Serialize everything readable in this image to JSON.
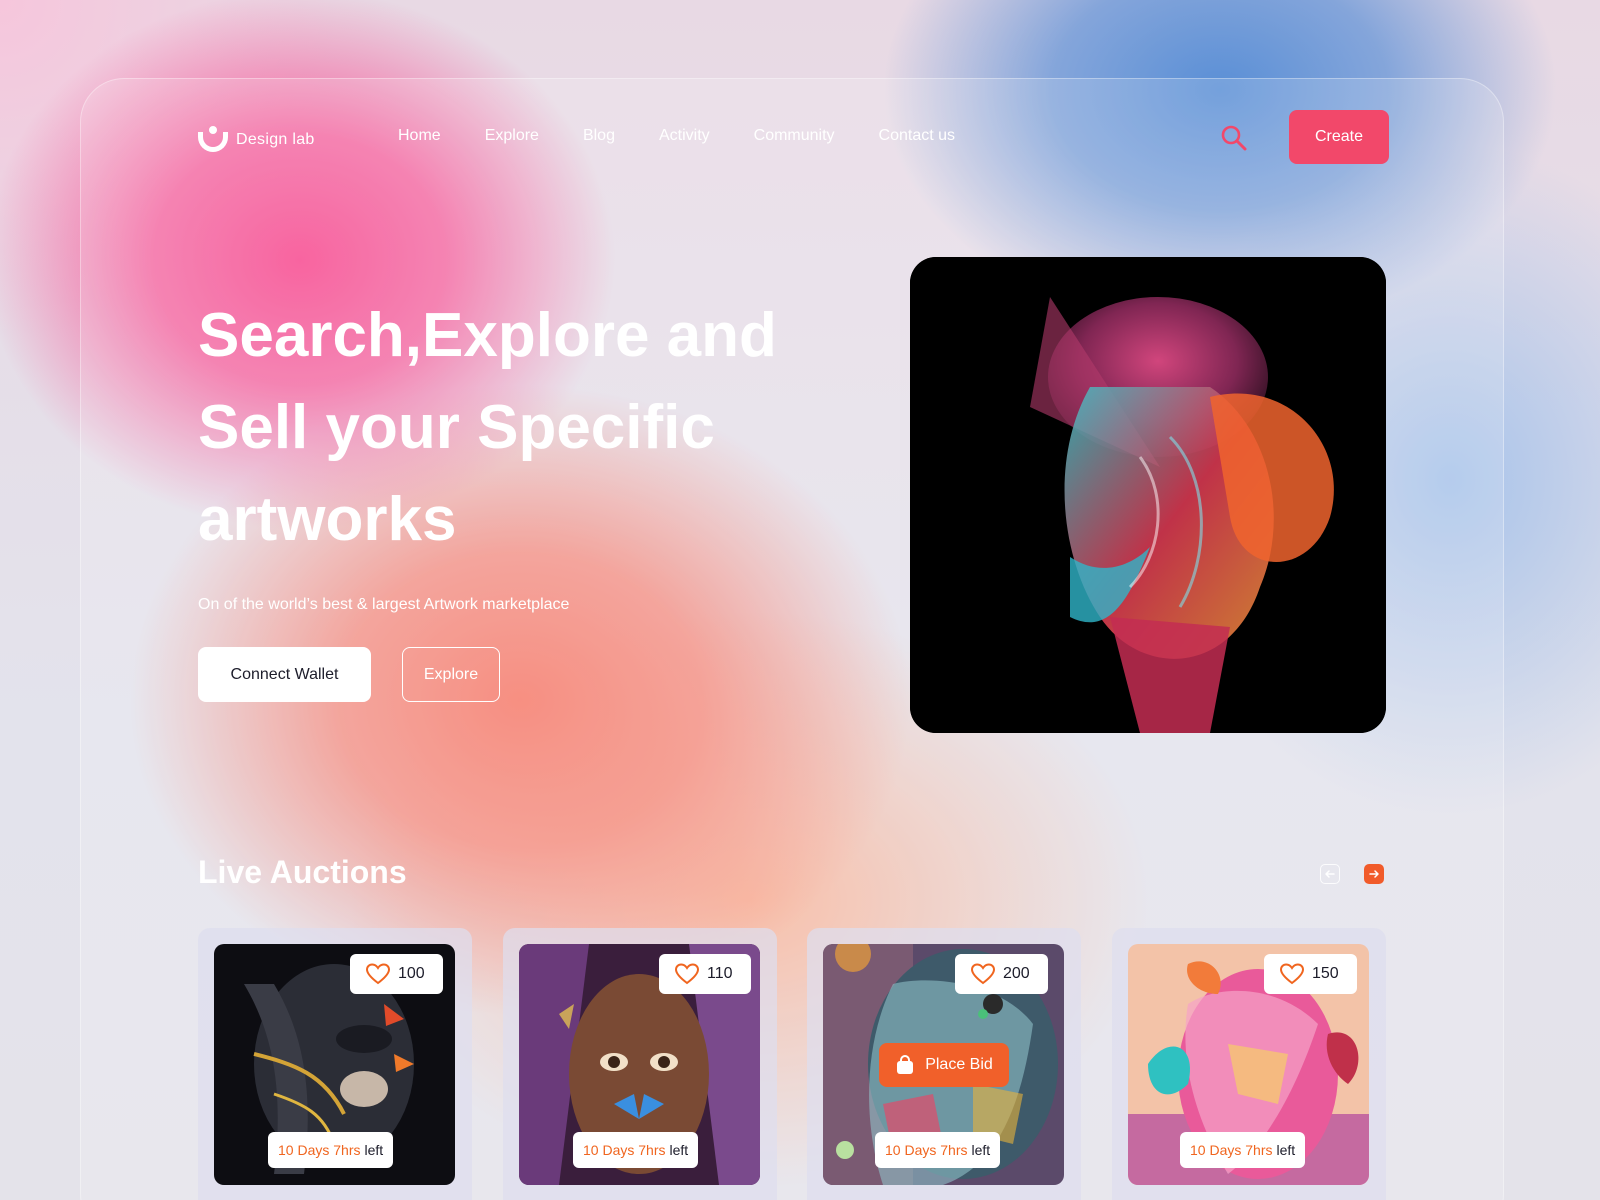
{
  "brand": {
    "name": "Design lab"
  },
  "nav": {
    "items": [
      "Home",
      "Explore",
      "Blog",
      "Activity",
      "Community",
      "Contact us"
    ]
  },
  "header": {
    "search_icon": "search-icon",
    "create_label": "Create"
  },
  "hero": {
    "title": "Search,Explore and Sell your Specific artworks",
    "subtitle": "On of the world’s best & largest Artwork marketplace",
    "connect_label": "Connect Wallet",
    "explore_label": "Explore"
  },
  "auctions": {
    "title": "Live Auctions",
    "cards": [
      {
        "likes": "100",
        "time": "10 Days 7hrs",
        "left": "left"
      },
      {
        "likes": "110",
        "time": "10 Days 7hrs",
        "left": "left"
      },
      {
        "likes": "200",
        "time": "10 Days 7hrs",
        "left": "left",
        "bid": "Place Bid"
      },
      {
        "likes": "150",
        "time": "10 Days 7hrs",
        "left": "left"
      }
    ]
  },
  "colors": {
    "accent_pink": "#f2486a",
    "accent_orange": "#f15b2a",
    "timer_orange": "#f0651f"
  }
}
